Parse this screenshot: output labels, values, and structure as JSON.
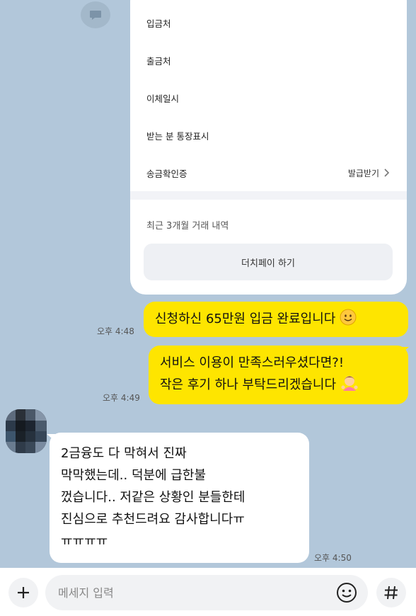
{
  "receipt": {
    "rows": [
      {
        "label": "입금처"
      },
      {
        "label": "출금처"
      },
      {
        "label": "이체일시"
      },
      {
        "label": "받는 분 통장표시"
      },
      {
        "label": "송금확인증",
        "action": "발급받기"
      }
    ],
    "recent_label": "최근 3개월 거래 내역",
    "pay_button": "더치페이 하기"
  },
  "messages": [
    {
      "lines": [
        "신청하신 65만원 입금 완료입니다"
      ],
      "time": "오후 4:48",
      "sender": "me",
      "emoji": "smile"
    },
    {
      "lines": [
        "서비스 이용이 만족스러우셨다면?!",
        "작은 후기 하나 부탁드리겠습니다"
      ],
      "time": "오후 4:49",
      "sender": "me",
      "emoji": "bow"
    },
    {
      "lines": [
        "2금융도 다 막혀서 진짜",
        "막막했는데.. 덕분에 급한불",
        "껐습니다.. 저같은 상황인 분들한테",
        "진심으로 추천드려요 감사합니다ㅠ",
        "ㅠㅠㅠㅠ"
      ],
      "time": "오후 4:50",
      "sender": "other"
    }
  ],
  "input": {
    "placeholder": "메세지 입력"
  },
  "icons": {
    "share": "share-icon",
    "plus": "plus-icon",
    "emoji": "emoji-icon",
    "hash": "hash-icon"
  },
  "colors": {
    "bg": "#b2c7da",
    "my_bubble": "#fee500",
    "other_bubble": "#ffffff"
  }
}
